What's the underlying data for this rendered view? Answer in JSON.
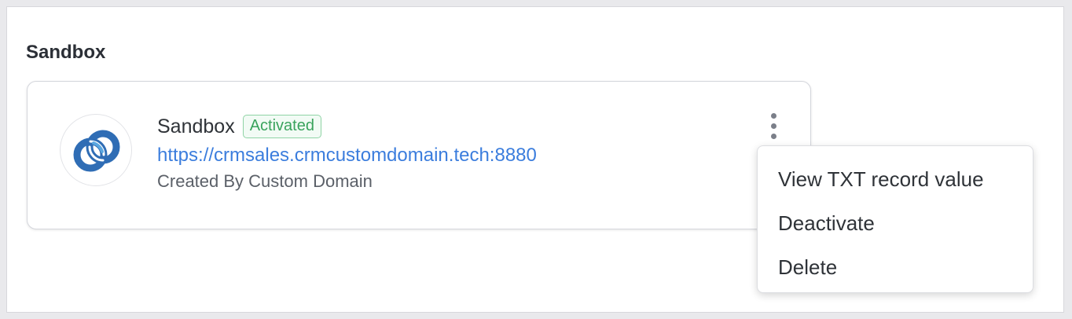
{
  "section": {
    "title": "Sandbox"
  },
  "card": {
    "name": "Sandbox",
    "status_badge": "Activated",
    "url": "https://crmsales.crmcustomdomain.tech:8880",
    "created_by": "Created By Custom Domain",
    "logo_icon": "linked-rings-logo-icon",
    "more_icon": "vertical-ellipsis-icon"
  },
  "menu": {
    "items": [
      {
        "label": "View TXT record value"
      },
      {
        "label": "Deactivate"
      },
      {
        "label": "Delete"
      }
    ]
  },
  "colors": {
    "link": "#3b7ddd",
    "badge_text": "#3aa35d",
    "badge_border": "#8fd3a5",
    "logo_blue": "#2f6db5",
    "logo_light": "#5aa7e0"
  }
}
